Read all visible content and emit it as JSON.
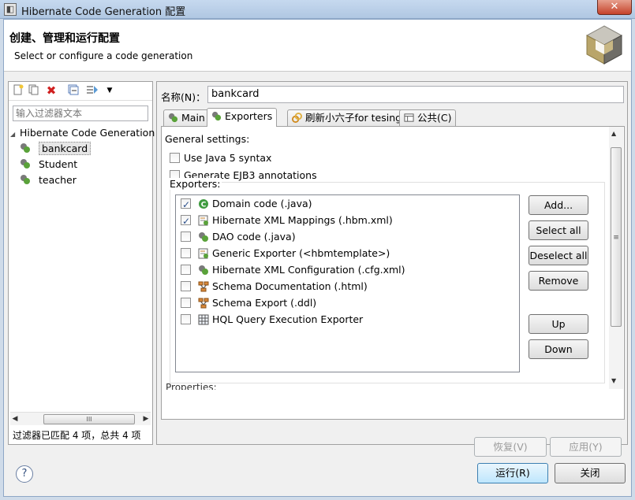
{
  "window": {
    "title": "Hibernate Code Generation 配置",
    "close": "✕"
  },
  "header": {
    "title": "创建、管理和运行配置",
    "subtitle": "Select or configure a code generation"
  },
  "left": {
    "filter_placeholder": "输入过滤器文本",
    "tree": {
      "root": "Hibernate Code Generation",
      "items": [
        "bankcard",
        "Student",
        "teacher"
      ],
      "selected": "bankcard"
    },
    "status": "过滤器已匹配 4 项，总共 4 项",
    "scroll_thumb": "III"
  },
  "right": {
    "name_label": "名称(N)：",
    "name_value": "bankcard",
    "tabs": [
      {
        "label": "Main",
        "active": false
      },
      {
        "label": "Exporters",
        "active": true
      },
      {
        "label": "刷新小六子for tesing",
        "active": false
      },
      {
        "label": "公共(C)",
        "active": false
      }
    ],
    "general_settings": "General settings:",
    "options": [
      {
        "label": "Use Java 5 syntax",
        "checked": false
      },
      {
        "label": "Generate EJB3 annotations",
        "checked": false
      }
    ],
    "exporters_label": "Exporters:",
    "exporters": [
      {
        "label": "Domain code (.java)",
        "checked": true,
        "icon": "java-class-icon"
      },
      {
        "label": "Hibernate XML Mappings (.hbm.xml)",
        "checked": true,
        "icon": "hbm-mapping-icon"
      },
      {
        "label": "DAO code (.java)",
        "checked": false,
        "icon": "hibernate-icon"
      },
      {
        "label": "Generic Exporter (<hbmtemplate>)",
        "checked": false,
        "icon": "hbm-mapping-icon"
      },
      {
        "label": "Hibernate XML Configuration (.cfg.xml)",
        "checked": false,
        "icon": "hibernate-icon"
      },
      {
        "label": "Schema Documentation (.html)",
        "checked": false,
        "icon": "schema-icon"
      },
      {
        "label": "Schema Export (.ddl)",
        "checked": false,
        "icon": "schema-icon"
      },
      {
        "label": "HQL Query Execution Exporter",
        "checked": false,
        "icon": "hql-icon"
      }
    ],
    "buttons": {
      "add": "Add...",
      "select_all": "Select all",
      "deselect_all": "Deselect all",
      "remove": "Remove",
      "up": "Up",
      "down": "Down"
    },
    "properties_partial": "Properties:",
    "revert": "恢复(V)",
    "apply": "应用(Y)"
  },
  "footer": {
    "run": "运行(R)",
    "close": "关闭",
    "help": "?"
  }
}
